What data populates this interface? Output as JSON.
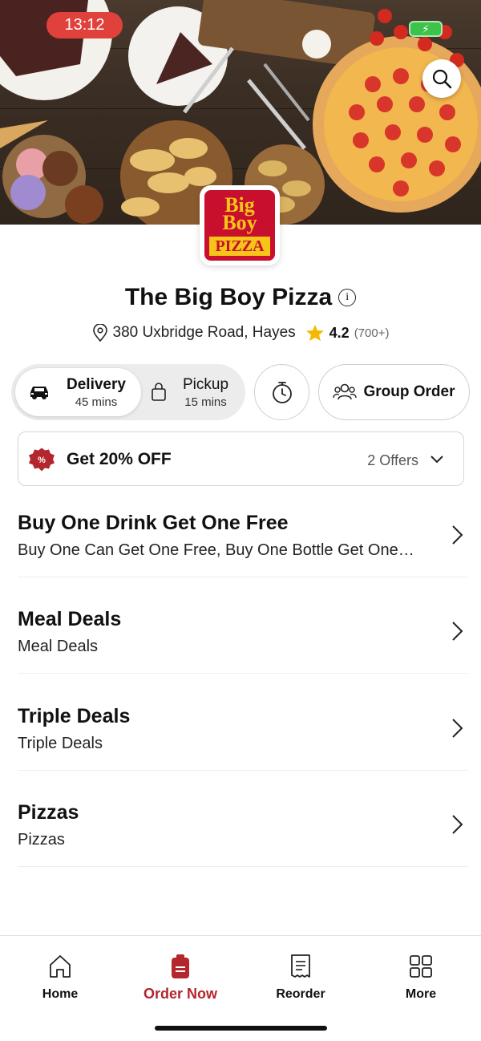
{
  "status": {
    "time": "13:12",
    "battery_icon": "battery-charging-icon"
  },
  "hero": {
    "search_icon": "search-icon"
  },
  "restaurant": {
    "logo_text_top": "Big Boy",
    "logo_text_bottom": "PIZZA",
    "name": "The Big Boy Pizza",
    "info_icon": "info-icon",
    "address": "380 Uxbridge Road, Hayes",
    "rating": "4.2",
    "rating_count": "(700+)"
  },
  "order_mode": {
    "delivery_label": "Delivery",
    "delivery_time": "45 mins",
    "pickup_label": "Pickup",
    "pickup_time": "15 mins",
    "schedule_icon": "timer-icon",
    "group_order_label": "Group Order"
  },
  "offer": {
    "title": "Get 20% OFF",
    "count": "2 Offers"
  },
  "categories": [
    {
      "title": "Buy One Drink Get One Free",
      "subtitle": "Buy One Can Get One Free, Buy One Bottle Get One Free"
    },
    {
      "title": "Meal Deals",
      "subtitle": "Meal Deals"
    },
    {
      "title": "Triple Deals",
      "subtitle": "Triple Deals"
    },
    {
      "title": "Pizzas",
      "subtitle": "Pizzas"
    }
  ],
  "nav": {
    "home": "Home",
    "order_now": "Order Now",
    "reorder": "Reorder",
    "more": "More"
  },
  "colors": {
    "brand": "#b3262d",
    "accent_star": "#f5b800"
  }
}
